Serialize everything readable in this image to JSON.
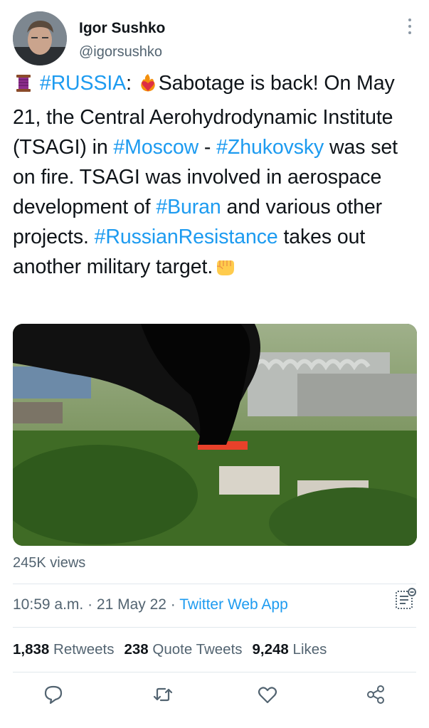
{
  "author": {
    "name": "Igor Sushko",
    "handle": "@igorsushko",
    "avatar_icon": "avatar-photo"
  },
  "tweet": {
    "p1": "#RUSSIA",
    "p2": ": ",
    "p3": "Sabotage is back! On May 21, the Central Aerohydrodynamic Institute (TSAGI) in ",
    "p4": "#Moscow",
    "p5": " - ",
    "p6": "#Zhukovsky",
    "p7": " was set on fire. TSAGI was involved in aerospace development of ",
    "p8": "#Buran",
    "p9": " and various other projects. ",
    "p10": "#RussianResistance",
    "p11": " takes out another military target.",
    "emoji_1": "thread-spool-emoji",
    "emoji_2": "heart-on-fire-emoji",
    "emoji_3": "raised-fist-emoji"
  },
  "media": {
    "alt": "Aerial photo of black smoke rising from a burning building in a wooded industrial area"
  },
  "views": "245K views",
  "meta": {
    "time": "10:59 a.m.",
    "sep1": " · ",
    "date": "21 May 22",
    "sep2": " · ",
    "source": "Twitter Web App"
  },
  "stats": {
    "retweets_count": "1,838",
    "retweets_label": "Retweets",
    "quotes_count": "238",
    "quotes_label": "Quote Tweets",
    "likes_count": "9,248",
    "likes_label": "Likes"
  },
  "actions": [
    "reply-icon",
    "retweet-icon",
    "like-icon",
    "share-icon"
  ],
  "colors": {
    "link": "#1d9bf0",
    "text": "#0f1419",
    "secondary": "#536471",
    "divider": "#e1e8ed"
  }
}
